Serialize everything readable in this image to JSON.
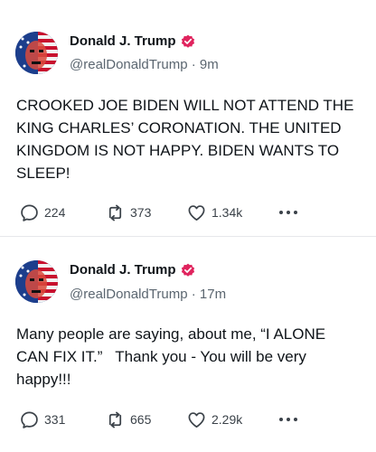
{
  "posts": [
    {
      "author": {
        "display_name": "Donald J. Trump",
        "handle": "@realDonaldTrump",
        "time": "9m",
        "verified": true
      },
      "separator": " · ",
      "text": "CROOKED JOE BIDEN WILL NOT ATTEND THE KING CHARLES’ CORONATION. THE UNITED KINGDOM IS NOT HAPPY. BIDEN WANTS TO SLEEP!",
      "stats": {
        "replies": "224",
        "reposts": "373",
        "likes": "1.34k"
      }
    },
    {
      "author": {
        "display_name": "Donald J. Trump",
        "handle": "@realDonaldTrump",
        "time": "17m",
        "verified": true
      },
      "separator": " · ",
      "text": "Many people are saying, about me, “I ALONE CAN FIX IT.”   Thank you - You will be very happy!!!",
      "stats": {
        "replies": "331",
        "reposts": "665",
        "likes": "2.29k"
      }
    }
  ],
  "icons": {
    "reply": "reply-icon",
    "repost": "repost-icon",
    "like": "heart-icon",
    "more": "more-icon",
    "verified": "verified-badge-icon"
  },
  "colors": {
    "verified_badge": "#e0245e",
    "text": "#0f1419",
    "secondary": "#5b6670"
  }
}
